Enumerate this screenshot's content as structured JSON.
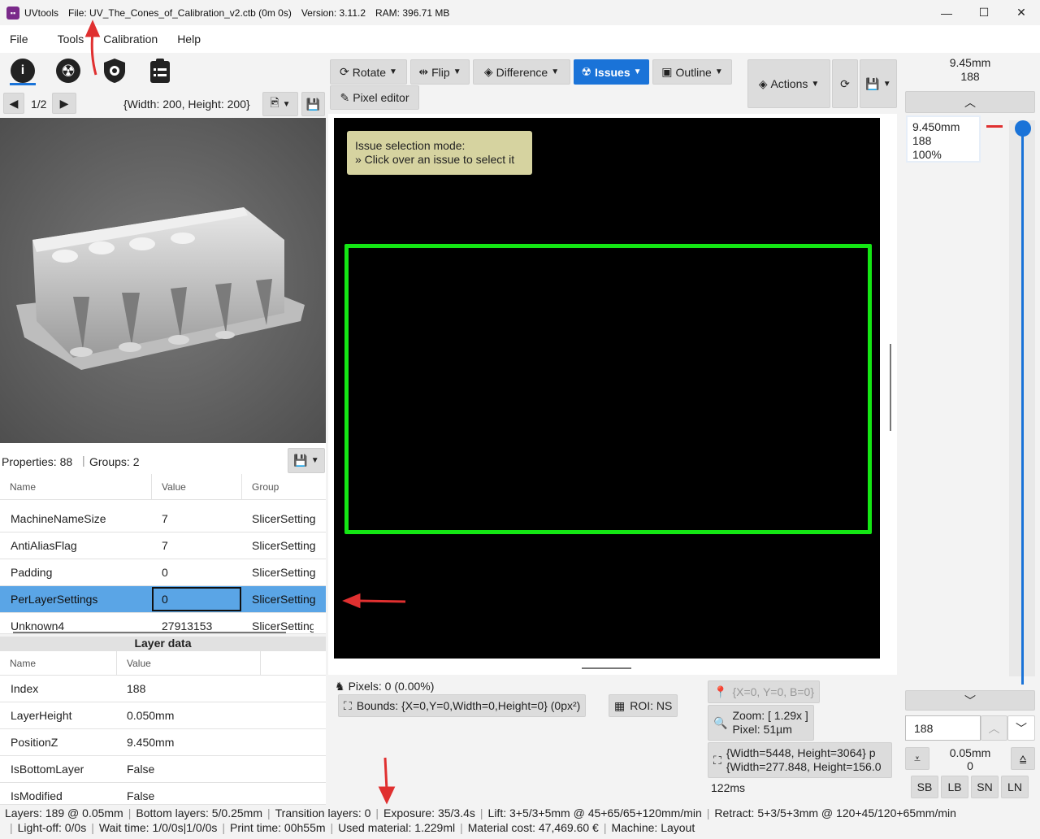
{
  "window": {
    "app_name": "UVtools",
    "file": "File: UV_The_Cones_of_Calibration_v2.ctb (0m 0s)",
    "version": "Version: 3.11.2",
    "ram": "RAM: 396.71 MB"
  },
  "menu": [
    "File",
    "Tools",
    "Calibration",
    "Help"
  ],
  "left_toolbar": {
    "page_indicator": "1/2",
    "dimensions": "{Width: 200, Height: 200}"
  },
  "properties": {
    "summary": "Properties: 88",
    "groups": "Groups: 2",
    "columns": [
      "Name",
      "Value",
      "Group"
    ],
    "rows": [
      {
        "name": "MachineNameSize",
        "value": "7",
        "group": "SlicerSetting"
      },
      {
        "name": "AntiAliasFlag",
        "value": "7",
        "group": "SlicerSetting"
      },
      {
        "name": "Padding",
        "value": "0",
        "group": "SlicerSetting"
      },
      {
        "name": "PerLayerSettings",
        "value": "0",
        "group": "SlicerSetting"
      },
      {
        "name": "Unknown4",
        "value": "27913153",
        "group": "SlicerSetting"
      }
    ]
  },
  "layer_data": {
    "title": "Layer data",
    "columns": [
      "Name",
      "Value"
    ],
    "rows": [
      {
        "name": "Index",
        "value": "188"
      },
      {
        "name": "LayerHeight",
        "value": "0.050mm"
      },
      {
        "name": "PositionZ",
        "value": "9.450mm"
      },
      {
        "name": "IsBottomLayer",
        "value": "False"
      },
      {
        "name": "IsModified",
        "value": "False"
      }
    ]
  },
  "main_toolbar": {
    "rotate": "Rotate",
    "flip": "Flip",
    "difference": "Difference",
    "issues": "Issues",
    "outline": "Outline",
    "pixel_editor": "Pixel editor",
    "actions": "Actions"
  },
  "canvas": {
    "issue_tip_line1": "Issue selection mode:",
    "issue_tip_line2": "» Click over an issue to select it"
  },
  "bottom_info": {
    "pixels": "Pixels: 0 (0.00%)",
    "bounds": "Bounds: {X=0,Y=0,Width=0,Height=0} (0px²)",
    "roi": "ROI: NS",
    "coords": "{X=0, Y=0, B=0}",
    "zoom": "Zoom: [ 1.29x ]",
    "pixel_size": "Pixel: 51µm",
    "res1": "{Width=5448, Height=3064} p",
    "res2": "{Width=277.848, Height=156.0",
    "time": "122ms"
  },
  "layer_slider": {
    "top_height": "9.45mm",
    "top_layer": "188",
    "tip_height": "9.450mm",
    "tip_layer": "188",
    "tip_percent": "100%",
    "input_value": "188",
    "bottom_height": "0.05mm",
    "bottom_layer": "0",
    "buttons": [
      "SB",
      "LB",
      "SN",
      "LN"
    ],
    "position_fraction": 1.0
  },
  "status": {
    "line1": [
      "Layers: 189 @ 0.05mm",
      "Bottom layers: 5/0.25mm",
      "Transition layers: 0",
      "Exposure: 35/3.4s",
      "Lift: 3+5/3+5mm @ 45+65/65+120mm/min",
      "Retract: 5+3/5+3mm @ 120+45/120+65mm/min"
    ],
    "line2": [
      "Light-off: 0/0s",
      "Wait time: 1/0/0s|1/0/0s",
      "Print time: 00h55m",
      "Used material: 1.229ml",
      "Material cost: 47,469.60 €",
      "Machine: Layout"
    ]
  },
  "colors": {
    "accent": "#1a73d8",
    "selection": "#5aa5e6",
    "issue_outline": "#14e614",
    "annotation_arrow": "#e03030"
  }
}
